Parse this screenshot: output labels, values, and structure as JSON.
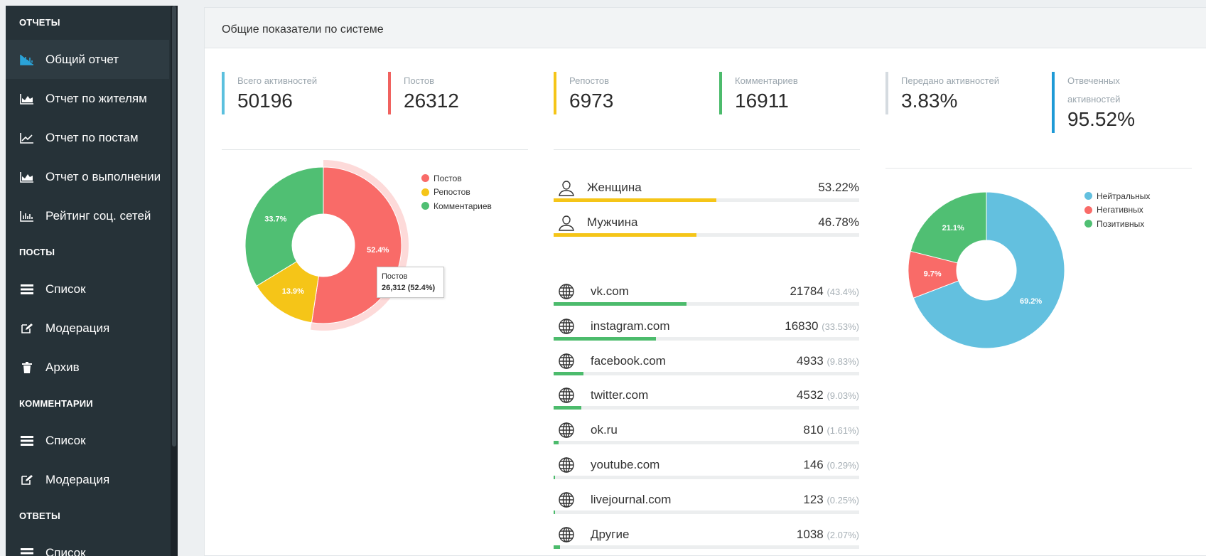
{
  "sidebar": {
    "sections": [
      {
        "title": "ОТЧЕТЫ",
        "items": [
          "Общий отчет",
          "Отчет по жителям",
          "Отчет по постам",
          "Отчет о выполнении",
          "Рейтинг соц. сетей"
        ]
      },
      {
        "title": "ПОСТЫ",
        "items": [
          "Список",
          "Модерация",
          "Архив"
        ]
      },
      {
        "title": "КОММЕНТАРИИ",
        "items": [
          "Список",
          "Модерация"
        ]
      },
      {
        "title": "ОТВЕТЫ",
        "items": [
          "Список"
        ]
      }
    ],
    "active_item": "Общий отчет",
    "accent": "#2aa3d8"
  },
  "panel": {
    "title": "Общие показатели по системе"
  },
  "stats": [
    {
      "label": "Всего активностей",
      "value": "50196",
      "color": "#5bc0de"
    },
    {
      "label": "Постов",
      "value": "26312",
      "color": "#f0625f"
    },
    {
      "label": "Репостов",
      "value": "6973",
      "color": "#f5c518"
    },
    {
      "label": "Комментариев",
      "value": "16911",
      "color": "#4cbb6c"
    },
    {
      "label": "Передано активностей",
      "value": "3.83%",
      "color": "#d5dbe0"
    },
    {
      "label": "Отвеченных активностей",
      "label_line1": "Отвеченных",
      "label_line2": "активностей",
      "value": "95.52%",
      "color": "#1e9ad6"
    }
  ],
  "tooltip": {
    "line1": "Постов",
    "line2": "26,312 (52.4%)"
  },
  "gender": [
    {
      "label": "Женщина",
      "value": "53.22%",
      "fraction": 0.5322,
      "color": "#f5c518"
    },
    {
      "label": "Мужчина",
      "value": "46.78%",
      "fraction": 0.4678,
      "color": "#f5c518"
    }
  ],
  "sites": [
    {
      "name": "vk.com",
      "count": "21784",
      "pct": "(43.4%)",
      "fraction": 0.434
    },
    {
      "name": "instagram.com",
      "count": "16830",
      "pct": "(33.53%)",
      "fraction": 0.3353
    },
    {
      "name": "facebook.com",
      "count": "4933",
      "pct": "(9.83%)",
      "fraction": 0.0983
    },
    {
      "name": "twitter.com",
      "count": "4532",
      "pct": "(9.03%)",
      "fraction": 0.0903
    },
    {
      "name": "ok.ru",
      "count": "810",
      "pct": "(1.61%)",
      "fraction": 0.0161
    },
    {
      "name": "youtube.com",
      "count": "146",
      "pct": "(0.29%)",
      "fraction": 0.0029
    },
    {
      "name": "livejournal.com",
      "count": "123",
      "pct": "(0.25%)",
      "fraction": 0.0025
    },
    {
      "name": "Другие",
      "count": "1038",
      "pct": "(2.07%)",
      "fraction": 0.0207
    }
  ],
  "site_bar_color": "#4cbb6c",
  "chart_data": [
    {
      "type": "pie",
      "donut": true,
      "labels": [
        "Постов",
        "Репостов",
        "Комментариев"
      ],
      "values": [
        52.4,
        13.9,
        33.7
      ],
      "value_labels": [
        "52.4%",
        "13.9%",
        "33.7%"
      ],
      "colors": [
        "#f96b68",
        "#f5c518",
        "#50bf73"
      ],
      "legend_position": "top-right"
    },
    {
      "type": "pie",
      "donut": true,
      "labels": [
        "Нейтральных",
        "Негативных",
        "Позитивных"
      ],
      "values": [
        69.2,
        9.7,
        21.1
      ],
      "value_labels": [
        "69.2%",
        "9.7%",
        "21.1%"
      ],
      "colors": [
        "#63c0df",
        "#f96b68",
        "#50bf73"
      ],
      "legend_position": "top-right"
    }
  ]
}
